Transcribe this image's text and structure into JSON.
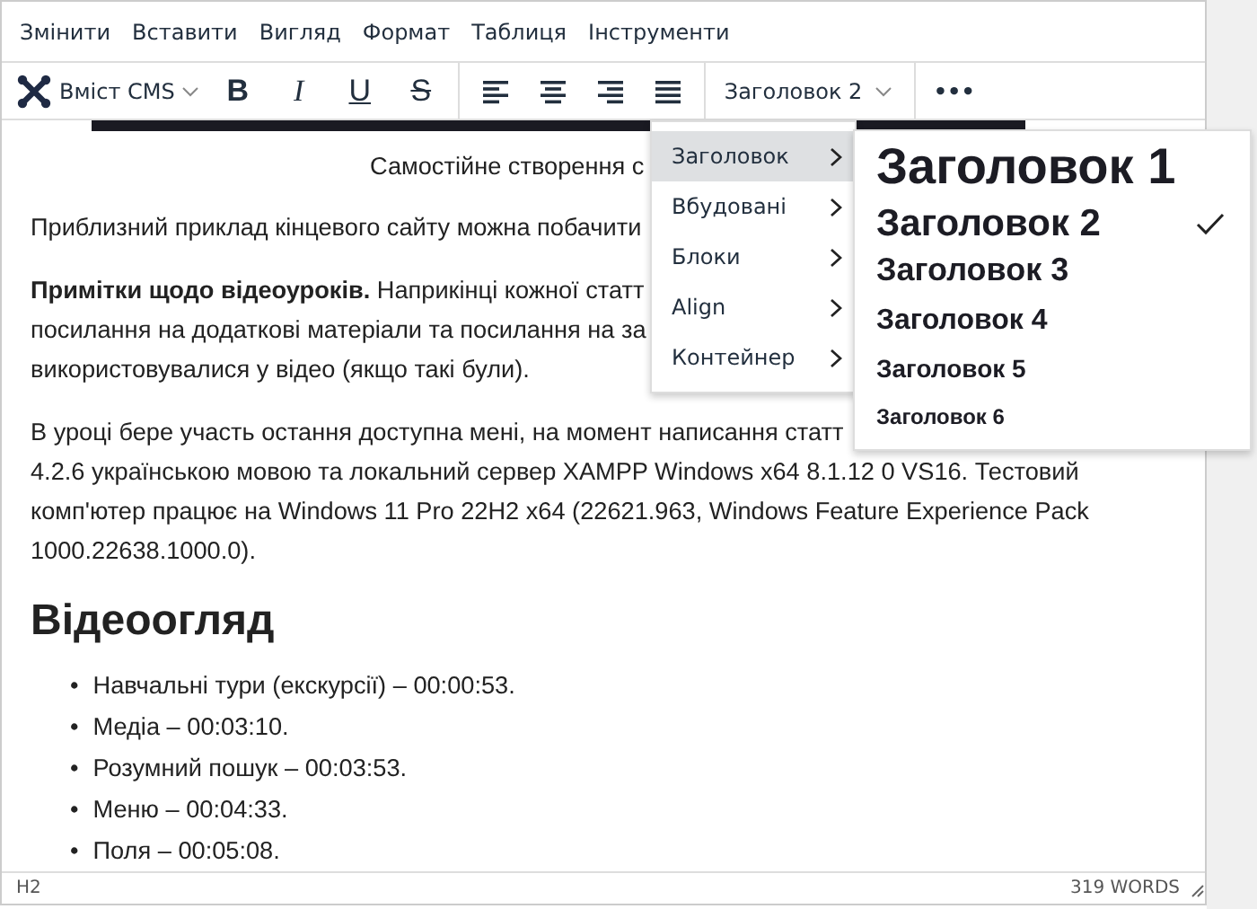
{
  "menubar": [
    "Змінити",
    "Вставити",
    "Вигляд",
    "Формат",
    "Таблиця",
    "Інструменти"
  ],
  "toolbar": {
    "cms_label": "Вміст CMS",
    "buttons": [
      {
        "kind": "bold",
        "label": "B"
      },
      {
        "kind": "italic",
        "label": "I"
      },
      {
        "kind": "underline",
        "label": "U"
      },
      {
        "kind": "strike",
        "label": "S"
      }
    ],
    "block_format": "Заголовок 2",
    "more": "•••"
  },
  "content": {
    "title": "Самостійне створення с",
    "paragraphs": [
      [
        "Приблизний приклад кінцевого сайту можна побачити"
      ],
      [
        "**Примітки щодо відеоуроків.** Наприкінці кожної статт",
        "посилання на додаткові матеріали та посилання на за",
        "використовувалися у відео (якщо такі були)."
      ],
      [
        "В уроці бере участь остання доступна мені, на момент написання статт",
        "4.2.6  українською мовою та локальний сервер XAMPP Windows x64 8.1.12 0 VS16. Тестовий",
        "комп'ютер працює на Windows 11 Pro 22H2 x64 (22621.963, Windows Feature Experience Pack",
        "1000.22638.1000.0)."
      ]
    ],
    "heading": "Відеоогляд",
    "list_marker": "•",
    "list": [
      "Навчальні тури (екскурсії) – 00:00:53.",
      "Медіа – 00:03:10.",
      "Розумний пошук – 00:03:53.",
      "Меню – 00:04:33.",
      "Поля – 00:05:08."
    ]
  },
  "format_menu": [
    {
      "label": "Заголовок",
      "selected": true
    },
    {
      "label": "Вбудовані",
      "selected": false
    },
    {
      "label": "Блоки",
      "selected": false
    },
    {
      "label": "Align",
      "selected": false
    },
    {
      "label": "Контейнер",
      "selected": false
    }
  ],
  "heading_menu": [
    {
      "label": "Заголовок 1",
      "kind": "h1",
      "checked": false
    },
    {
      "label": "Заголовок 2",
      "kind": "h2",
      "checked": true
    },
    {
      "label": "Заголовок 3",
      "kind": "h3",
      "checked": false
    },
    {
      "label": "Заголовок 4",
      "kind": "h4",
      "checked": false
    },
    {
      "label": "Заголовок 5",
      "kind": "h5",
      "checked": false
    },
    {
      "label": "Заголовок 6",
      "kind": "h6",
      "checked": false
    }
  ],
  "status_bar": {
    "path": "H2",
    "word_count": "319 WORDS"
  }
}
